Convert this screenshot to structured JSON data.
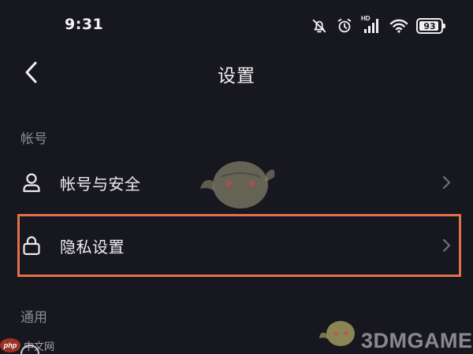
{
  "status_bar": {
    "time": "9:31",
    "network_badge": "HD",
    "battery_level": "93"
  },
  "header": {
    "title": "设置",
    "back_icon": "chevron-left-icon"
  },
  "sections": [
    {
      "label": "帐号",
      "items": [
        {
          "label": "帐号与安全",
          "icon": "person-icon"
        },
        {
          "label": "隐私设置",
          "icon": "lock-icon",
          "highlighted": true
        }
      ]
    },
    {
      "label": "通用",
      "items": []
    }
  ],
  "watermark": {
    "brand_text": "3DMGAME",
    "php_logo": "php",
    "php_text": "中文网"
  },
  "colors": {
    "background": "#17171f",
    "highlight": "#e2714a",
    "section_label": "#8a8a93"
  }
}
